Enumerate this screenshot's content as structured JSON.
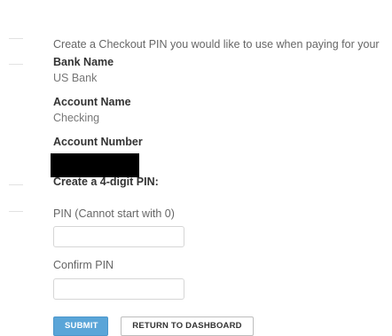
{
  "intro": {
    "text": "Create a Checkout PIN you would like to use when paying for your"
  },
  "bank": {
    "name_label": "Bank Name",
    "name_value": "US Bank"
  },
  "account": {
    "name_label": "Account Name",
    "name_value": "Checking",
    "number_label": "Account Number"
  },
  "pin_form": {
    "heading": "Create a 4-digit PIN:",
    "pin_label": "PIN (Cannot start with 0)",
    "pin_value": "",
    "confirm_label": "Confirm PIN",
    "confirm_value": ""
  },
  "actions": {
    "submit_label": "SUBMIT",
    "return_label": "RETURN TO DASHBOARD"
  },
  "colors": {
    "submit_bg": "#5aa5d8",
    "redaction": "#000000"
  }
}
